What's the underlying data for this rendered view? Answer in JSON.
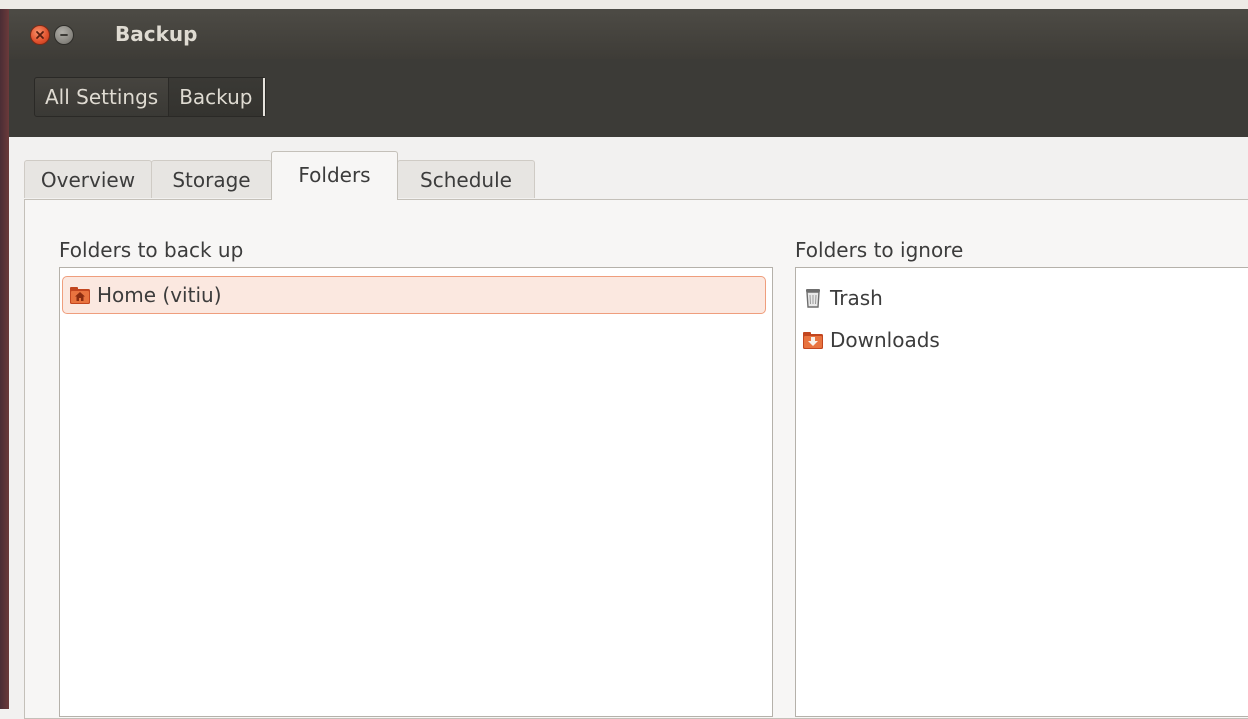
{
  "window": {
    "title": "Backup"
  },
  "breadcrumbs": {
    "items": [
      {
        "label": "All Settings"
      },
      {
        "label": "Backup"
      }
    ]
  },
  "tabs": [
    {
      "label": "Overview"
    },
    {
      "label": "Storage"
    },
    {
      "label": "Folders",
      "active": true
    },
    {
      "label": "Schedule"
    }
  ],
  "folders": {
    "backup_label": "Folders to back up",
    "ignore_label": "Folders to ignore",
    "backup_items": [
      {
        "label": "Home (vitiu)",
        "icon": "home-folder-icon",
        "selected": true
      }
    ],
    "ignore_items": [
      {
        "label": "Trash",
        "icon": "trash-icon"
      },
      {
        "label": "Downloads",
        "icon": "downloads-folder-icon"
      }
    ]
  },
  "colors": {
    "accent": "#e0502c",
    "selection_bg": "#fbe8e0",
    "selection_border": "#ef9e7d",
    "titlebar": "#3c3b37"
  }
}
